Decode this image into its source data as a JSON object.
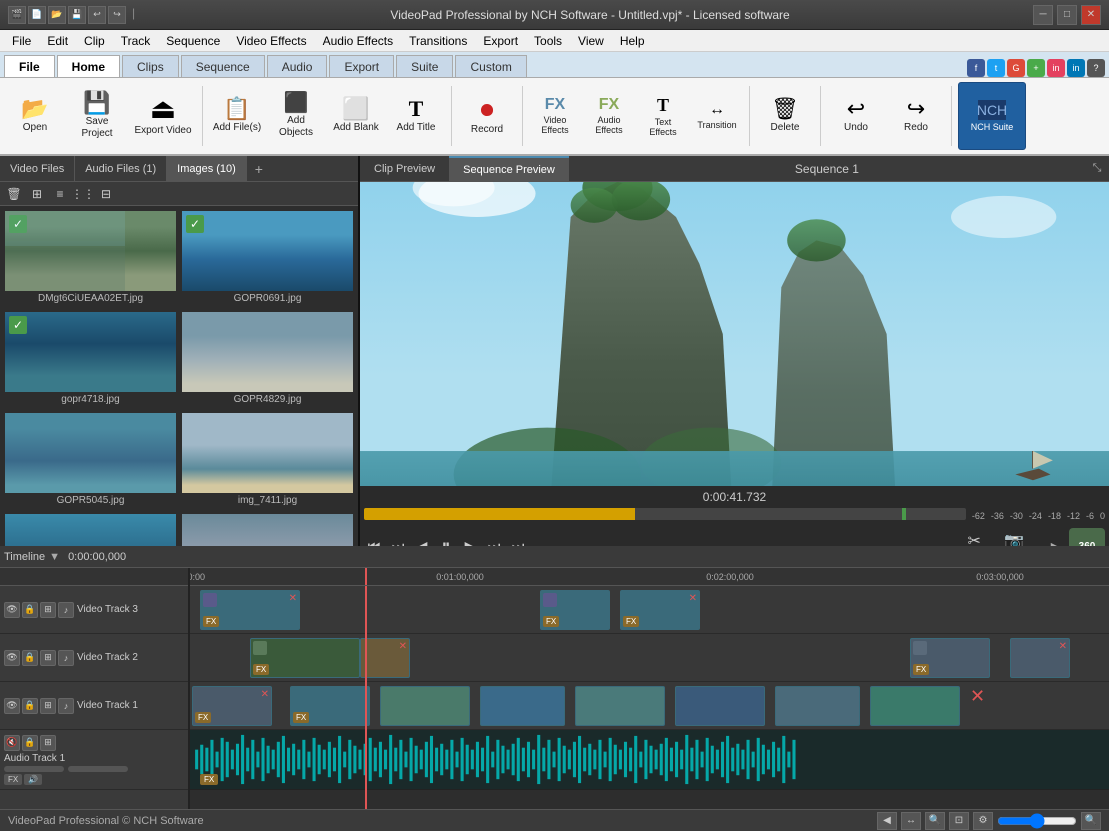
{
  "titlebar": {
    "icons": [
      "new",
      "open",
      "save",
      "undo",
      "redo"
    ],
    "title": "VideoPad Professional by NCH Software - Untitled.vpj* - Licensed software",
    "win_controls": [
      "minimize",
      "maximize",
      "close"
    ]
  },
  "menubar": {
    "items": [
      "File",
      "Edit",
      "Clip",
      "Track",
      "Sequence",
      "Video Effects",
      "Audio Effects",
      "Transitions",
      "Export",
      "Tools",
      "View",
      "Help"
    ]
  },
  "ribbon_tabs": {
    "tabs": [
      "File",
      "Home",
      "Clips",
      "Sequence",
      "Audio",
      "Export",
      "Suite",
      "Custom"
    ],
    "active": "Home"
  },
  "toolbar": {
    "buttons": [
      {
        "id": "open",
        "icon": "📂",
        "label": "Open"
      },
      {
        "id": "save-project",
        "icon": "💾",
        "label": "Save Project"
      },
      {
        "id": "export-video",
        "icon": "🎬",
        "label": "Export Video"
      },
      {
        "id": "add-files",
        "icon": "📄",
        "label": "Add File(s)"
      },
      {
        "id": "add-objects",
        "icon": "🔲",
        "label": "Add Objects"
      },
      {
        "id": "add-blank",
        "icon": "⬜",
        "label": "Add Blank"
      },
      {
        "id": "add-title",
        "icon": "T",
        "label": "Add Title"
      },
      {
        "id": "record",
        "icon": "⏺",
        "label": "Record"
      },
      {
        "id": "video-effects",
        "icon": "FX",
        "label": "Video Effects"
      },
      {
        "id": "audio-effects",
        "icon": "FX",
        "label": "Audio Effects"
      },
      {
        "id": "text-effects",
        "icon": "T",
        "label": "Text Effects"
      },
      {
        "id": "transition",
        "icon": "↔",
        "label": "Transition"
      },
      {
        "id": "delete",
        "icon": "🗑",
        "label": "Delete"
      },
      {
        "id": "undo",
        "icon": "↩",
        "label": "Undo"
      },
      {
        "id": "redo",
        "icon": "↪",
        "label": "Redo"
      },
      {
        "id": "nch-suite",
        "icon": "⬛",
        "label": "NCH Suite"
      }
    ]
  },
  "media_panel": {
    "tabs": [
      {
        "id": "video-files",
        "label": "Video Files"
      },
      {
        "id": "audio-files",
        "label": "Audio Files (1)"
      },
      {
        "id": "images",
        "label": "Images (10)",
        "active": true
      }
    ],
    "toolbar_tools": [
      "delete",
      "small-view",
      "list-view",
      "details-view",
      "options"
    ],
    "items": [
      {
        "id": "img1",
        "name": "DMgt6CiUEAA02ET.jpg",
        "thumb": "rock",
        "checked": true
      },
      {
        "id": "img2",
        "name": "GOPR0691.jpg",
        "thumb": "ocean",
        "checked": true
      },
      {
        "id": "img3",
        "name": "gopr4718.jpg",
        "thumb": "ocean2",
        "checked": true
      },
      {
        "id": "img4",
        "name": "GOPR4829.jpg",
        "thumb": "person",
        "checked": false
      },
      {
        "id": "img5",
        "name": "GOPR5045.jpg",
        "thumb": "coral",
        "checked": false
      },
      {
        "id": "img6",
        "name": "img_7411.jpg",
        "thumb": "boat",
        "checked": false
      },
      {
        "id": "img7",
        "name": "",
        "thumb": "ocean3",
        "checked": false
      },
      {
        "id": "img8",
        "name": "",
        "thumb": "person2",
        "checked": false
      },
      {
        "id": "img9",
        "name": "",
        "thumb": "placeholder",
        "checked": false
      }
    ]
  },
  "preview": {
    "tabs": [
      "Clip Preview",
      "Sequence Preview"
    ],
    "active_tab": "Sequence Preview",
    "title": "Sequence 1",
    "time": "0:00:41.732",
    "transport_buttons": [
      "skip-start",
      "prev-frame",
      "step-back",
      "play",
      "step-forward",
      "next-frame",
      "skip-end"
    ],
    "split_label": "Split",
    "snapshot_label": "Snapshot",
    "btn_360": "360"
  },
  "timeline": {
    "label": "Timeline",
    "current_time": "0:00:00,000",
    "time_markers": [
      "0:01:00,000",
      "0:02:00,000",
      "0:03:00,000"
    ],
    "tracks": [
      {
        "id": "video3",
        "name": "Video Track 3",
        "type": "video"
      },
      {
        "id": "video2",
        "name": "Video Track 2",
        "type": "video"
      },
      {
        "id": "video1",
        "name": "Video Track 1",
        "type": "video"
      },
      {
        "id": "audio1",
        "name": "Audio Track 1",
        "type": "audio"
      }
    ]
  },
  "bottom_bar": {
    "status": "VideoPad Professional © NCH Software",
    "tools": [
      "prev",
      "zoom-out",
      "zoom-in",
      "fit",
      "settings"
    ]
  }
}
